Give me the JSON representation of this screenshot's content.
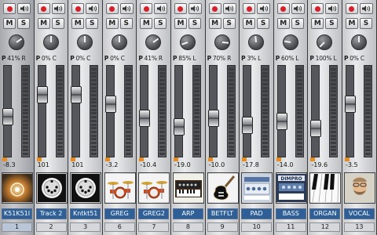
{
  "buttons": {
    "mute": "M",
    "solo": "S"
  },
  "pan_prefix": "P",
  "colors": {
    "record": "#d3202a",
    "clip": "#e48b22",
    "name_bg": "#2e5f96"
  },
  "tracks": [
    {
      "name": "K51K51I",
      "number": "1",
      "pan": "41% R",
      "volume": "-8.3",
      "icon": "instrument-photo-icon",
      "fader_level": 0.44,
      "knob_angle": 55
    },
    {
      "name": "Track 2",
      "number": "2",
      "pan": "0% C",
      "volume": "101",
      "icon": "midi-port-icon",
      "fader_level": 0.73,
      "knob_angle": 0
    },
    {
      "name": "Kntkt51",
      "number": "3",
      "pan": "0% C",
      "volume": "101",
      "icon": "midi-port-icon",
      "fader_level": 0.73,
      "knob_angle": 0
    },
    {
      "name": "GREG",
      "number": "6",
      "pan": "0% C",
      "volume": "-3.2",
      "icon": "drum-kit-icon",
      "fader_level": 0.6,
      "knob_angle": 0
    },
    {
      "name": "GREG2",
      "number": "7",
      "pan": "41% R",
      "volume": "-10.4",
      "icon": "drum-kit-icon",
      "fader_level": 0.42,
      "knob_angle": 55
    },
    {
      "name": "ARP",
      "number": "8",
      "pan": "85% L",
      "volume": "-19.0",
      "icon": "synth-keyboard-icon",
      "fader_level": 0.3,
      "knob_angle": -110
    },
    {
      "name": "BETFLT",
      "number": "9",
      "pan": "70% R",
      "volume": "-10.0",
      "icon": "electric-guitar-icon",
      "fader_level": 0.42,
      "knob_angle": 95
    },
    {
      "name": "PAD",
      "number": "10",
      "pan": "3% L",
      "volume": "-17.8",
      "icon": "synth-plugin-icon",
      "fader_level": 0.32,
      "knob_angle": -5
    },
    {
      "name": "BASS",
      "number": "11",
      "pan": "60% L",
      "volume": "-14.0",
      "icon": "bass-plugin-icon",
      "fader_level": 0.38,
      "knob_angle": -80
    },
    {
      "name": "ORGAN",
      "number": "12",
      "pan": "100% L",
      "volume": "-19.6",
      "icon": "piano-keys-icon",
      "fader_level": 0.28,
      "knob_angle": -135
    },
    {
      "name": "VOCAL",
      "number": "13",
      "pan": "0% C",
      "volume": "-3.5",
      "icon": "singer-photo-icon",
      "fader_level": 0.6,
      "knob_angle": 0
    }
  ]
}
